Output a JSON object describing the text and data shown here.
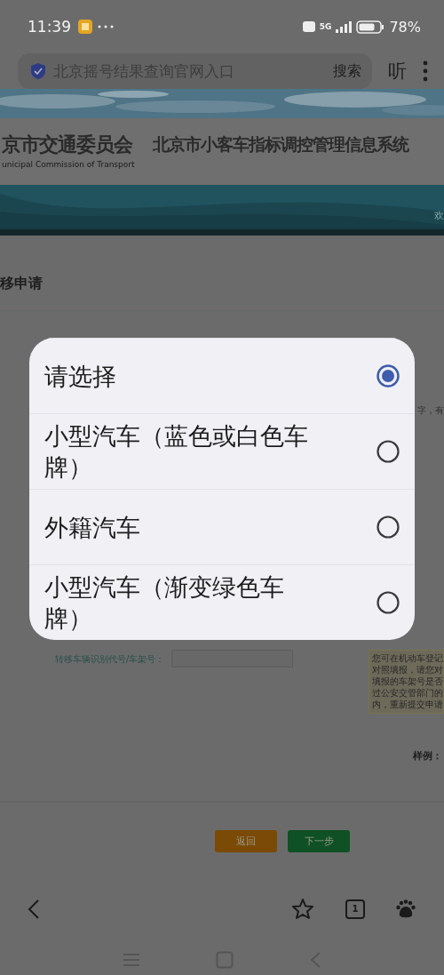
{
  "status_bar": {
    "time": "11:39",
    "network": "5G",
    "battery": "78%"
  },
  "address_bar": {
    "value": "北京摇号结果查询官网入口",
    "search_button": "搜索",
    "listen_button": "听"
  },
  "site_header": {
    "org_name": "京市交通委员会",
    "org_name_en": "unicipal Commission of Transport",
    "system_title": "北京市小客车指标调控管理信息系统",
    "welcome": "欢"
  },
  "form": {
    "heading": "移申请",
    "hint_top": "字，有",
    "field": {
      "label": "转移车辆识别代号/车架号：",
      "note_lines": [
        "您可在机动车登记",
        "对照填报，请您对",
        "填报的车架号是否",
        "过公安交管部门的",
        "内，重新提交申请"
      ]
    },
    "sample_label": "样例：",
    "buttons": [
      {
        "label": "返回",
        "kind": "back"
      },
      {
        "label": "下一步",
        "kind": "next"
      }
    ]
  },
  "dialog": {
    "options": [
      {
        "label": "请选择",
        "selected": true
      },
      {
        "label": "小型汽车（蓝色或白色车牌）",
        "selected": false
      },
      {
        "label": "外籍汽车",
        "selected": false
      },
      {
        "label": "小型汽车（渐变绿色车牌）",
        "selected": false
      }
    ]
  },
  "browser_toolbar": {
    "tab_count": "1"
  }
}
